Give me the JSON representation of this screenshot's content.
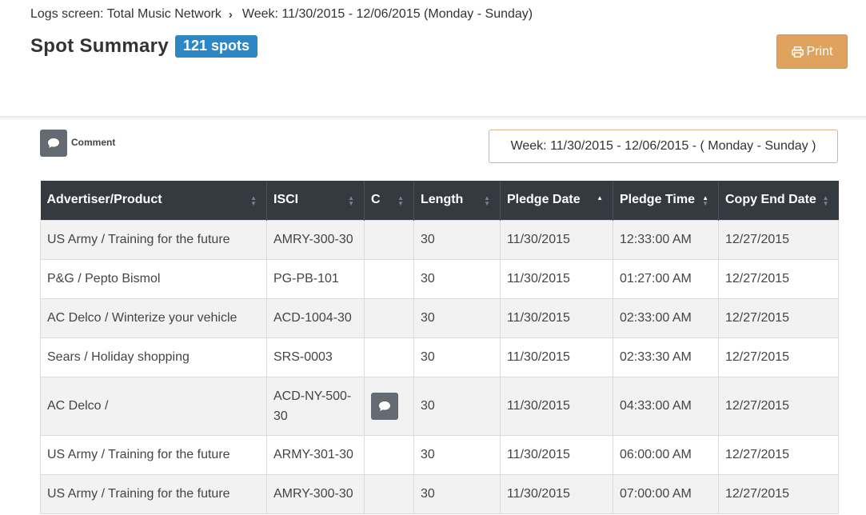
{
  "breadcrumb": {
    "screen": "Logs screen: Total Music Network",
    "separator": "›",
    "week": "Week: 11/30/2015 - 12/06/2015 (Monday - Sunday)"
  },
  "header": {
    "title": "Spot Summary",
    "badge": "121 spots",
    "print_label": "Print"
  },
  "legend": {
    "comment_label": "Comment"
  },
  "week_selector": "Week: 11/30/2015 - 12/06/2015 - ( Monday - Sunday )",
  "table": {
    "columns": [
      "Advertiser/Product",
      "ISCI",
      "C",
      "Length",
      "Pledge Date",
      "Pledge Time",
      "Copy End Date"
    ],
    "rows": [
      {
        "advertiser": "US Army / Training for the future",
        "isci": "AMRY-300-30",
        "comment": false,
        "length": "30",
        "pledge_date": "11/30/2015",
        "pledge_time": "12:33:00 AM",
        "copy_end": "12/27/2015"
      },
      {
        "advertiser": "P&G / Pepto Bismol",
        "isci": "PG-PB-101",
        "comment": false,
        "length": "30",
        "pledge_date": "11/30/2015",
        "pledge_time": "01:27:00 AM",
        "copy_end": "12/27/2015"
      },
      {
        "advertiser": "AC Delco / Winterize your vehicle",
        "isci": "ACD-1004-30",
        "comment": false,
        "length": "30",
        "pledge_date": "11/30/2015",
        "pledge_time": "02:33:00 AM",
        "copy_end": "12/27/2015"
      },
      {
        "advertiser": "Sears / Holiday shopping",
        "isci": "SRS-0003",
        "comment": false,
        "length": "30",
        "pledge_date": "11/30/2015",
        "pledge_time": "02:33:30 AM",
        "copy_end": "12/27/2015"
      },
      {
        "advertiser": "AC Delco /",
        "isci": "ACD-NY-500-30",
        "comment": true,
        "length": "30",
        "pledge_date": "11/30/2015",
        "pledge_time": "04:33:00 AM",
        "copy_end": "12/27/2015"
      },
      {
        "advertiser": "US Army / Training for the future",
        "isci": "ARMY-301-30",
        "comment": false,
        "length": "30",
        "pledge_date": "11/30/2015",
        "pledge_time": "06:00:00 AM",
        "copy_end": "12/27/2015"
      },
      {
        "advertiser": "US Army / Training for the future",
        "isci": "AMRY-300-30",
        "comment": false,
        "length": "30",
        "pledge_date": "11/30/2015",
        "pledge_time": "07:00:00 AM",
        "copy_end": "12/27/2015"
      }
    ]
  },
  "icons": {
    "print": "printer-icon",
    "comment": "comment-icon"
  },
  "colors": {
    "badge": "#2f86c4",
    "print_button": "#e0a35d",
    "table_header": "#343a40",
    "comment_icon_bg": "#636a72"
  }
}
